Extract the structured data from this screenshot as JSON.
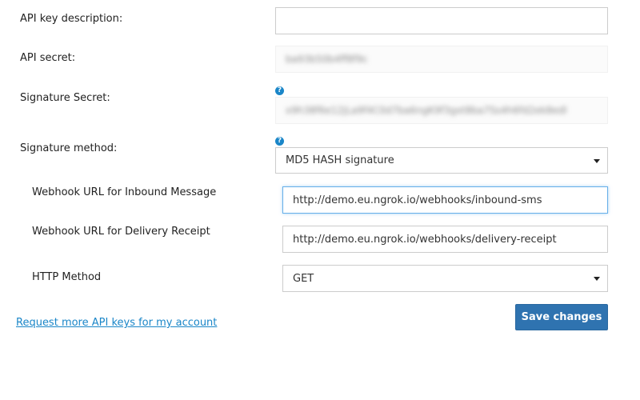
{
  "form": {
    "api_key_description": {
      "label": "API key description:",
      "value": ""
    },
    "api_secret": {
      "label": "API secret:",
      "value": "ba93b50b4ff8f9c"
    },
    "signature_secret": {
      "label": "Signature Secret:",
      "value": "x9h38f6e12jLa9f4C0d7ba6ngK9f3gxt8ba7Ss4h6fd2ek8edl",
      "help_icon": "question-circle"
    },
    "signature_method": {
      "label": "Signature method:",
      "selected": "MD5 HASH signature",
      "help_icon": "question-circle"
    },
    "webhook_inbound": {
      "label": "Webhook URL for Inbound Message",
      "value": "http://demo.eu.ngrok.io/webhooks/inbound-sms"
    },
    "webhook_delivery": {
      "label": "Webhook URL for Delivery Receipt",
      "value": "http://demo.eu.ngrok.io/webhooks/delivery-receipt"
    },
    "http_method": {
      "label": "HTTP Method",
      "selected": "GET"
    }
  },
  "actions": {
    "request_keys_link": "Request more API keys for my account",
    "save_button": "Save changes"
  },
  "colors": {
    "accent": "#1a86c8",
    "button": "#2f73b0",
    "focus_border": "#66afe9"
  }
}
